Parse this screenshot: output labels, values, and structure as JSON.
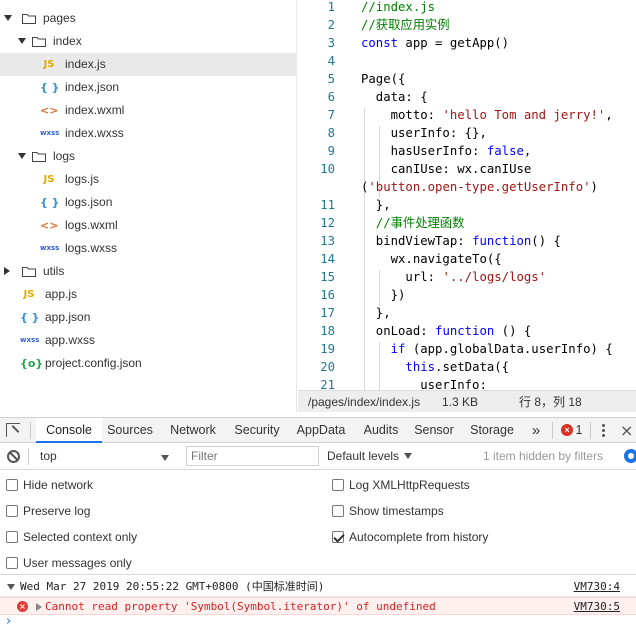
{
  "file_tree": [
    {
      "name": "pages",
      "kind": "folder",
      "expanded": true
    },
    {
      "name": "index",
      "kind": "folder",
      "expanded": true
    },
    {
      "name": "index.js",
      "kind": "js",
      "badge": "JS",
      "selected": true
    },
    {
      "name": "index.json",
      "kind": "json",
      "badge": "{ }"
    },
    {
      "name": "index.wxml",
      "kind": "wxml",
      "badge": "<>"
    },
    {
      "name": "index.wxss",
      "kind": "wxss",
      "badge": "wxss"
    },
    {
      "name": "logs",
      "kind": "folder",
      "expanded": true
    },
    {
      "name": "logs.js",
      "kind": "js",
      "badge": "JS"
    },
    {
      "name": "logs.json",
      "kind": "json",
      "badge": "{ }"
    },
    {
      "name": "logs.wxml",
      "kind": "wxml",
      "badge": "<>"
    },
    {
      "name": "logs.wxss",
      "kind": "wxss",
      "badge": "wxss"
    },
    {
      "name": "utils",
      "kind": "folder",
      "expanded": false
    },
    {
      "name": "app.js",
      "kind": "js",
      "badge": "JS"
    },
    {
      "name": "app.json",
      "kind": "json",
      "badge": "{ }"
    },
    {
      "name": "app.wxss",
      "kind": "wxss",
      "badge": "wxss"
    },
    {
      "name": "project.config.json",
      "kind": "cfg",
      "badge": "{o}"
    }
  ],
  "editor": {
    "lines": [
      {
        "n": "1",
        "code": "//index.js"
      },
      {
        "n": "2",
        "code": "//获取应用实例"
      },
      {
        "n": "3",
        "code": "const app = getApp()"
      },
      {
        "n": "4",
        "code": ""
      },
      {
        "n": "5",
        "code": "Page({"
      },
      {
        "n": "6",
        "code": "  data: {"
      },
      {
        "n": "7",
        "code": "    motto: 'hello Tom and jerry!',"
      },
      {
        "n": "8",
        "code": "    userInfo: {},"
      },
      {
        "n": "9",
        "code": "    hasUserInfo: false,"
      },
      {
        "n": "10",
        "code": "    canIUse: wx.canIUse"
      },
      {
        "n": "",
        "code": "('button.open-type.getUserInfo')"
      },
      {
        "n": "11",
        "code": "  },"
      },
      {
        "n": "12",
        "code": "  //事件处理函数"
      },
      {
        "n": "13",
        "code": "  bindViewTap: function() {"
      },
      {
        "n": "14",
        "code": "    wx.navigateTo({"
      },
      {
        "n": "15",
        "code": "      url: '../logs/logs'"
      },
      {
        "n": "16",
        "code": "    })"
      },
      {
        "n": "17",
        "code": "  },"
      },
      {
        "n": "18",
        "code": "  onLoad: function () {"
      },
      {
        "n": "19",
        "code": "    if (app.globalData.userInfo) {"
      },
      {
        "n": "20",
        "code": "      this.setData({"
      },
      {
        "n": "21",
        "code": "        userInfo:"
      }
    ]
  },
  "status_bar": {
    "path": "/pages/index/index.js",
    "size": "1.3 KB",
    "cursor": "行 8，列 18"
  },
  "devtools": {
    "tabs": [
      "Console",
      "Sources",
      "Network",
      "Security",
      "AppData",
      "Audits",
      "Sensor",
      "Storage"
    ],
    "active_tab": "Console",
    "more_label": "»",
    "error_count": "1",
    "context": "top",
    "filter_placeholder": "Filter",
    "levels_label": "Default levels",
    "hidden_text": "1 item hidden by filters",
    "options": [
      {
        "label": "Hide network",
        "checked": false
      },
      {
        "label": "Log XMLHttpRequests",
        "checked": false
      },
      {
        "label": "Preserve log",
        "checked": false
      },
      {
        "label": "Show timestamps",
        "checked": false
      },
      {
        "label": "Selected context only",
        "checked": false
      },
      {
        "label": "Autocomplete from history",
        "checked": true
      },
      {
        "label": "User messages only",
        "checked": false
      }
    ],
    "log_group": {
      "text": "Wed Mar 27 2019 20:55:22 GMT+0800 (中国标准时间)",
      "source": "VM730:4"
    },
    "log_error": {
      "text": "Cannot read property 'Symbol(Symbol.iterator)' of undefined",
      "source": "VM730:5"
    },
    "prompt": "›"
  }
}
